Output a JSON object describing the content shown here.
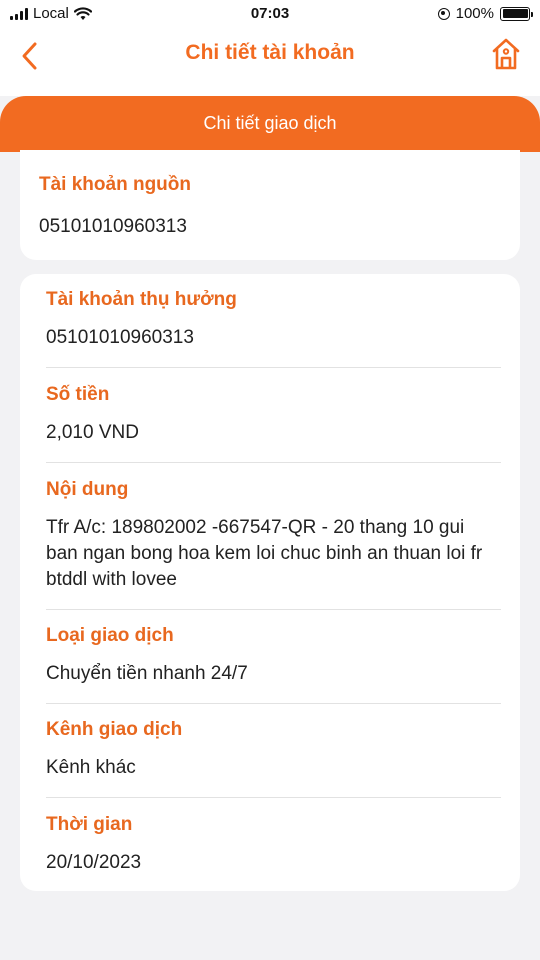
{
  "status_bar": {
    "carrier": "Local",
    "time": "07:03",
    "battery": "100%"
  },
  "header": {
    "title": "Chi tiết tài khoản",
    "back_icon": "chevron-left-icon",
    "home_icon": "home-icon"
  },
  "section_title": "Chi tiết giao dịch",
  "source_account": {
    "label": "Tài khoản nguồn",
    "value": "05101010960313"
  },
  "details": [
    {
      "label": "Tài khoản thụ hưởng",
      "value": "05101010960313"
    },
    {
      "label": "Số tiền",
      "value": "2,010 VND"
    },
    {
      "label": "Nội dung",
      "value": "Tfr A/c: 189802002 -667547-QR - 20 thang 10 gui ban ngan bong hoa kem loi chuc binh an thuan loi fr btddl with lovee"
    },
    {
      "label": "Loại giao dịch",
      "value": "Chuyển tiền nhanh 24/7"
    },
    {
      "label": "Kênh giao dịch",
      "value": "Kênh khác"
    },
    {
      "label": "Thời gian",
      "value": "20/10/2023"
    }
  ],
  "colors": {
    "accent": "#f26b21",
    "background": "#f2f2f4",
    "card": "#ffffff"
  }
}
